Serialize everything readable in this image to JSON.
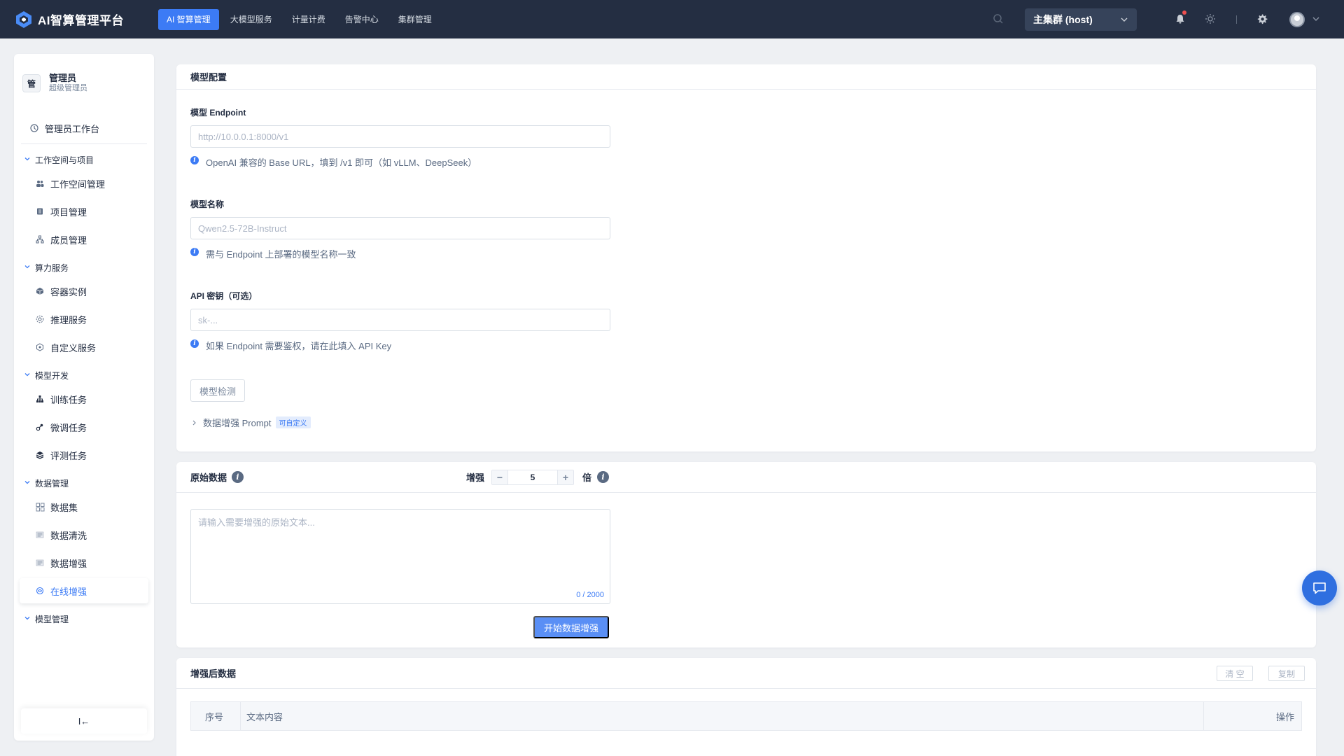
{
  "app": {
    "title": "AI智算管理平台"
  },
  "nav": {
    "items": [
      {
        "label": "AI 智算管理",
        "active": true
      },
      {
        "label": "大模型服务"
      },
      {
        "label": "计量计费"
      },
      {
        "label": "告警中心"
      },
      {
        "label": "集群管理"
      }
    ]
  },
  "topbar": {
    "cluster_label": "主集群 (host)",
    "icons": [
      "search-icon",
      "bell-icon",
      "theme-icon",
      "settings-icon",
      "avatar"
    ]
  },
  "sidebar": {
    "user_icon_text": "管",
    "user_name": "管理员",
    "user_role": "超级管理员",
    "workbench": "管理员工作台",
    "groups": [
      {
        "title": "工作空间与项目",
        "items": [
          "工作空间管理",
          "项目管理",
          "成员管理"
        ]
      },
      {
        "title": "算力服务",
        "items": [
          "容器实例",
          "推理服务",
          "自定义服务"
        ]
      },
      {
        "title": "模型开发",
        "items": [
          "训练任务",
          "微调任务",
          "评测任务"
        ]
      },
      {
        "title": "数据管理",
        "items": [
          "数据集",
          "数据清洗",
          "数据增强",
          "在线增强"
        ]
      },
      {
        "title": "模型管理",
        "items": []
      }
    ],
    "active_item": "在线增强",
    "collapse_glyph": "I←"
  },
  "model_config": {
    "title": "模型配置",
    "endpoint_label": "模型 Endpoint",
    "endpoint_placeholder": "http://10.0.0.1:8000/v1",
    "endpoint_hint": "OpenAI 兼容的 Base URL，填到 /v1 即可（如 vLLM、DeepSeek）",
    "model_name_label": "模型名称",
    "model_name_placeholder": "Qwen2.5-72B-Instruct",
    "model_name_hint": "需与 Endpoint 上部署的模型名称一致",
    "api_key_label": "API 密钥（可选）",
    "api_key_placeholder": "sk-...",
    "api_key_hint": "如果 Endpoint 需要鉴权，请在此填入 API Key",
    "detect_button": "模型检测",
    "prompt_label": "数据增强 Prompt",
    "prompt_tag": "可自定义"
  },
  "raw_data": {
    "title": "原始数据",
    "augment_label": "增强",
    "multiplier": "5",
    "multiplier_unit": "倍",
    "textarea_placeholder": "请输入需要增强的原始文本...",
    "counter": "0 / 2000",
    "start_button": "开始数据增强"
  },
  "augmented": {
    "title": "增强后数据",
    "clear_button": "清 空",
    "copy_button": "复制",
    "columns": [
      "序号",
      "文本内容",
      "操作"
    ]
  },
  "colors": {
    "topbar": "#242e42",
    "accent": "#3c7bf5",
    "primary_button": "#5a8ff5"
  }
}
